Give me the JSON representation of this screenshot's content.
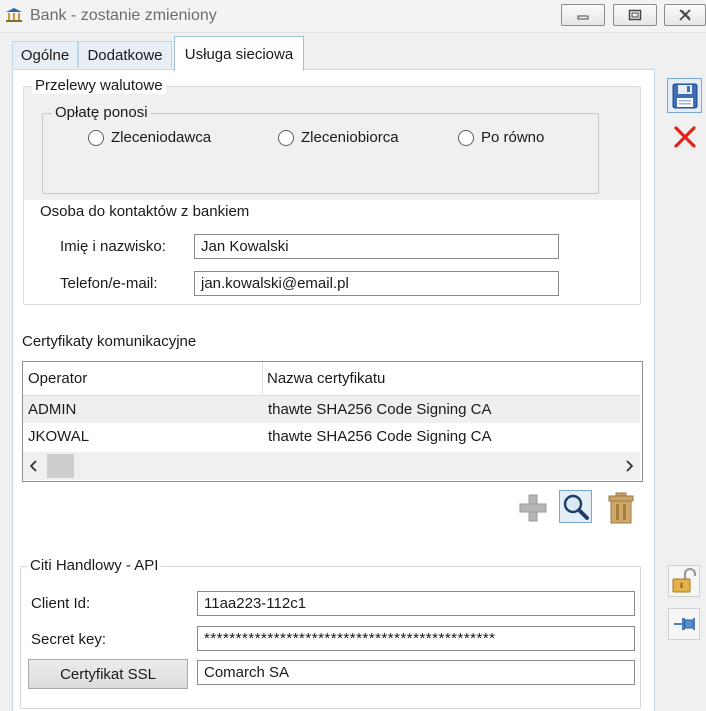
{
  "window": {
    "title": "Bank - zostanie zmieniony"
  },
  "tabs": [
    {
      "label": "Ogólne"
    },
    {
      "label": "Dodatkowe"
    },
    {
      "label": "Usługa sieciowa"
    }
  ],
  "przelewy": {
    "group_title": "Przelewy walutowe",
    "oplate_title": "Opłatę ponosi",
    "options": [
      {
        "label": "Zleceniodawca"
      },
      {
        "label": "Zleceniobiorca"
      },
      {
        "label": "Po równo"
      }
    ]
  },
  "kontakt": {
    "section_title": "Osoba do kontaktów z bankiem",
    "name_label": "Imię i nazwisko:",
    "name_value": "Jan Kowalski",
    "phone_label": "Telefon/e-mail:",
    "phone_value": "jan.kowalski@email.pl"
  },
  "certyfikaty": {
    "section_title": "Certyfikaty komunikacyjne",
    "columns": [
      "Operator",
      "Nazwa certyfikatu"
    ],
    "rows": [
      {
        "operator": "ADMIN",
        "nazwa": "thawte SHA256 Code Signing CA"
      },
      {
        "operator": "JKOWAL",
        "nazwa": "thawte SHA256 Code Signing CA"
      }
    ]
  },
  "citi": {
    "group_title": "Citi Handlowy - API",
    "client_id_label": "Client Id:",
    "client_id_value": "11aa223-112c1",
    "secret_label": "Secret key:",
    "secret_value": "**********************************************",
    "ssl_button": "Certyfikat SSL",
    "ssl_value": "Comarch SA"
  },
  "icons": {
    "save": "save-icon",
    "cancel": "close-icon",
    "add": "plus-icon",
    "view": "magnifier-icon",
    "delete": "trash-icon",
    "lock": "unlock-icon",
    "pin": "pin-icon"
  }
}
